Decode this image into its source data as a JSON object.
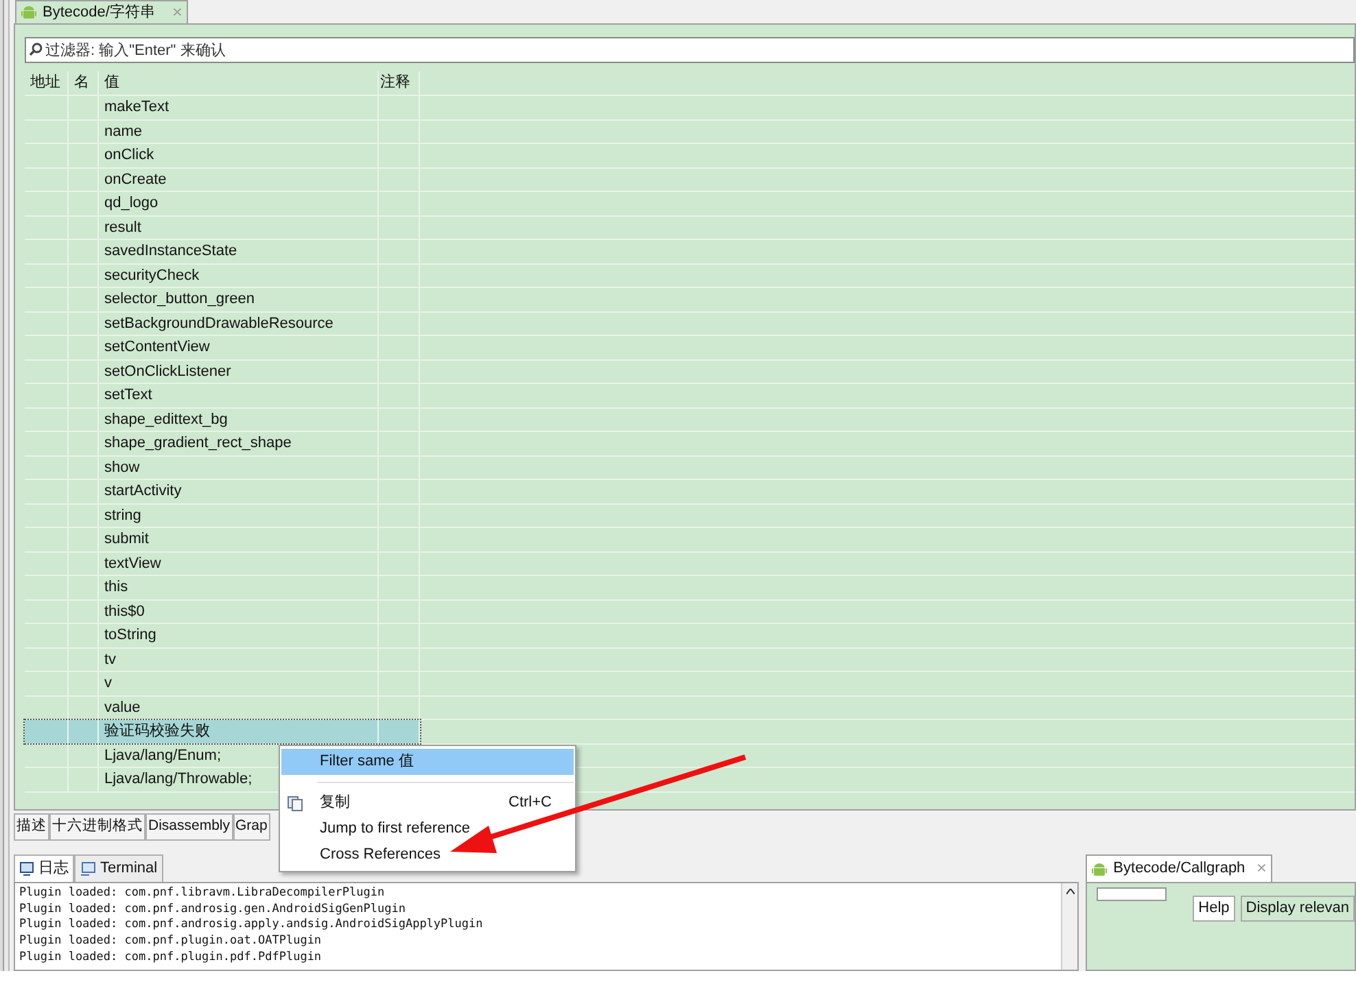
{
  "editor_tab": {
    "title": "Bytecode/字符串",
    "close": "⨯"
  },
  "filter": {
    "placeholder": "过滤器: 输入\"Enter\" 来确认"
  },
  "table": {
    "columns": [
      "地址",
      "名",
      "值",
      "注释"
    ],
    "rows": [
      {
        "value": "makeText",
        "selected": false
      },
      {
        "value": "name",
        "selected": false
      },
      {
        "value": "onClick",
        "selected": false
      },
      {
        "value": "onCreate",
        "selected": false
      },
      {
        "value": "qd_logo",
        "selected": false
      },
      {
        "value": "result",
        "selected": false
      },
      {
        "value": "savedInstanceState",
        "selected": false
      },
      {
        "value": "securityCheck",
        "selected": false
      },
      {
        "value": "selector_button_green",
        "selected": false
      },
      {
        "value": "setBackgroundDrawableResource",
        "selected": false
      },
      {
        "value": "setContentView",
        "selected": false
      },
      {
        "value": "setOnClickListener",
        "selected": false
      },
      {
        "value": "setText",
        "selected": false
      },
      {
        "value": "shape_edittext_bg",
        "selected": false
      },
      {
        "value": "shape_gradient_rect_shape",
        "selected": false
      },
      {
        "value": "show",
        "selected": false
      },
      {
        "value": "startActivity",
        "selected": false
      },
      {
        "value": "string",
        "selected": false
      },
      {
        "value": "submit",
        "selected": false
      },
      {
        "value": "textView",
        "selected": false
      },
      {
        "value": "this",
        "selected": false
      },
      {
        "value": "this$0",
        "selected": false
      },
      {
        "value": "toString",
        "selected": false
      },
      {
        "value": "tv",
        "selected": false
      },
      {
        "value": "v",
        "selected": false
      },
      {
        "value": "value",
        "selected": false
      },
      {
        "value": "验证码校验失败",
        "selected": true
      },
      {
        "value": "Ljava/lang/Enum;",
        "selected": false
      },
      {
        "value": "Ljava/lang/Throwable;",
        "selected": false
      }
    ]
  },
  "bottom_tabs": [
    {
      "label": "描述"
    },
    {
      "label": "十六进制格式"
    },
    {
      "label": "Disassembly"
    },
    {
      "label": "Grap"
    }
  ],
  "context_menu": [
    {
      "kind": "item",
      "label": "Filter same 值",
      "icon": false,
      "selected": true
    },
    {
      "kind": "separator"
    },
    {
      "kind": "item",
      "label": "复制",
      "shortcut": "Ctrl+C",
      "icon": true,
      "selected": false
    },
    {
      "kind": "item",
      "label": "Jump to first reference",
      "icon": false,
      "selected": false
    },
    {
      "kind": "item",
      "label": "Cross References",
      "icon": false,
      "selected": false
    }
  ],
  "log_panel": {
    "tabs": [
      {
        "label": "日志",
        "selected": true
      },
      {
        "label": "Terminal",
        "selected": false
      }
    ],
    "lines": [
      "Plugin loaded: com.pnf.libravm.LibraDecompilerPlugin",
      "Plugin loaded: com.pnf.androsig.gen.AndroidSigGenPlugin",
      "Plugin loaded: com.pnf.androsig.apply.andsig.AndroidSigApplyPlugin",
      "Plugin loaded: com.pnf.plugin.oat.OATPlugin",
      "Plugin loaded: com.pnf.plugin.pdf.PdfPlugin"
    ]
  },
  "callgraph_panel": {
    "title": "Bytecode/Callgraph",
    "close": "⨯",
    "buttons": [
      "Help",
      "Display relevan"
    ]
  }
}
